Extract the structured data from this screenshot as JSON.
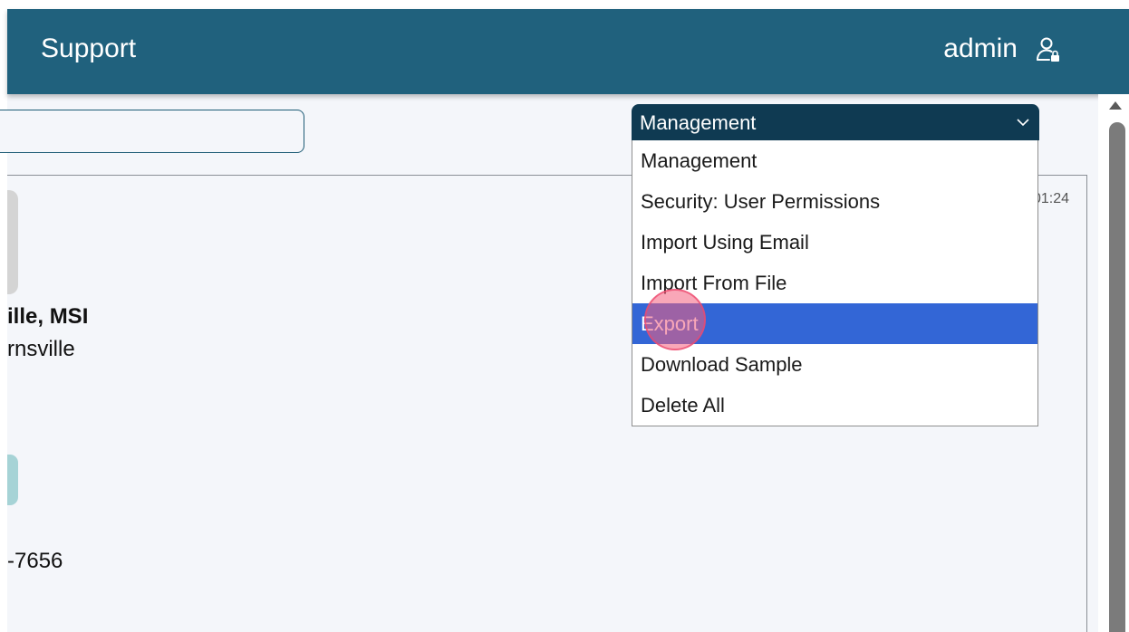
{
  "header": {
    "title": "Support",
    "user": "admin",
    "user_icon": "user-lock-icon"
  },
  "profile": {
    "name_fragment": "ille, MSI",
    "city_fragment": "rnsville",
    "phone_fragment": "-7656",
    "time_fragment": "01:24"
  },
  "management_select": {
    "value": "Management",
    "chevron_icon": "chevron-down-icon",
    "options": [
      "Management",
      "Security: User Permissions",
      "Import Using Email",
      "Import From File",
      "Export",
      "Download Sample",
      "Delete All"
    ],
    "highlighted": "Export"
  },
  "colors": {
    "header_bg": "#20617d",
    "select_bg": "#0f3a52",
    "highlight": "#3366d6",
    "click_marker": "#f45e7e"
  }
}
